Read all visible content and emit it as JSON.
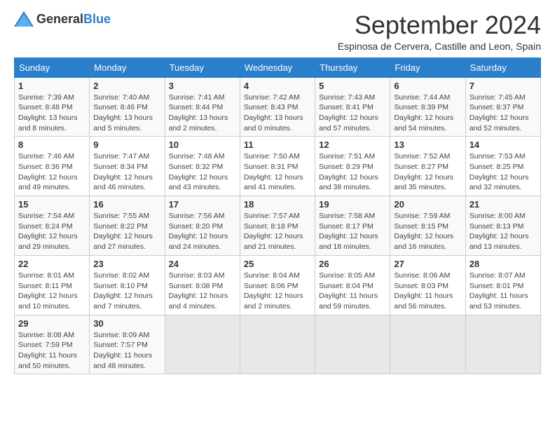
{
  "logo": {
    "general": "General",
    "blue": "Blue"
  },
  "title": "September 2024",
  "location": "Espinosa de Cervera, Castille and Leon, Spain",
  "headers": [
    "Sunday",
    "Monday",
    "Tuesday",
    "Wednesday",
    "Thursday",
    "Friday",
    "Saturday"
  ],
  "weeks": [
    [
      {
        "day": "1",
        "sunrise": "7:39 AM",
        "sunset": "8:48 PM",
        "daylight": "13 hours and 8 minutes."
      },
      {
        "day": "2",
        "sunrise": "7:40 AM",
        "sunset": "8:46 PM",
        "daylight": "13 hours and 5 minutes."
      },
      {
        "day": "3",
        "sunrise": "7:41 AM",
        "sunset": "8:44 PM",
        "daylight": "13 hours and 2 minutes."
      },
      {
        "day": "4",
        "sunrise": "7:42 AM",
        "sunset": "8:43 PM",
        "daylight": "13 hours and 0 minutes."
      },
      {
        "day": "5",
        "sunrise": "7:43 AM",
        "sunset": "8:41 PM",
        "daylight": "12 hours and 57 minutes."
      },
      {
        "day": "6",
        "sunrise": "7:44 AM",
        "sunset": "8:39 PM",
        "daylight": "12 hours and 54 minutes."
      },
      {
        "day": "7",
        "sunrise": "7:45 AM",
        "sunset": "8:37 PM",
        "daylight": "12 hours and 52 minutes."
      }
    ],
    [
      {
        "day": "8",
        "sunrise": "7:46 AM",
        "sunset": "8:36 PM",
        "daylight": "12 hours and 49 minutes."
      },
      {
        "day": "9",
        "sunrise": "7:47 AM",
        "sunset": "8:34 PM",
        "daylight": "12 hours and 46 minutes."
      },
      {
        "day": "10",
        "sunrise": "7:48 AM",
        "sunset": "8:32 PM",
        "daylight": "12 hours and 43 minutes."
      },
      {
        "day": "11",
        "sunrise": "7:50 AM",
        "sunset": "8:31 PM",
        "daylight": "12 hours and 41 minutes."
      },
      {
        "day": "12",
        "sunrise": "7:51 AM",
        "sunset": "8:29 PM",
        "daylight": "12 hours and 38 minutes."
      },
      {
        "day": "13",
        "sunrise": "7:52 AM",
        "sunset": "8:27 PM",
        "daylight": "12 hours and 35 minutes."
      },
      {
        "day": "14",
        "sunrise": "7:53 AM",
        "sunset": "8:25 PM",
        "daylight": "12 hours and 32 minutes."
      }
    ],
    [
      {
        "day": "15",
        "sunrise": "7:54 AM",
        "sunset": "8:24 PM",
        "daylight": "12 hours and 29 minutes."
      },
      {
        "day": "16",
        "sunrise": "7:55 AM",
        "sunset": "8:22 PM",
        "daylight": "12 hours and 27 minutes."
      },
      {
        "day": "17",
        "sunrise": "7:56 AM",
        "sunset": "8:20 PM",
        "daylight": "12 hours and 24 minutes."
      },
      {
        "day": "18",
        "sunrise": "7:57 AM",
        "sunset": "8:18 PM",
        "daylight": "12 hours and 21 minutes."
      },
      {
        "day": "19",
        "sunrise": "7:58 AM",
        "sunset": "8:17 PM",
        "daylight": "12 hours and 18 minutes."
      },
      {
        "day": "20",
        "sunrise": "7:59 AM",
        "sunset": "8:15 PM",
        "daylight": "12 hours and 16 minutes."
      },
      {
        "day": "21",
        "sunrise": "8:00 AM",
        "sunset": "8:13 PM",
        "daylight": "12 hours and 13 minutes."
      }
    ],
    [
      {
        "day": "22",
        "sunrise": "8:01 AM",
        "sunset": "8:11 PM",
        "daylight": "12 hours and 10 minutes."
      },
      {
        "day": "23",
        "sunrise": "8:02 AM",
        "sunset": "8:10 PM",
        "daylight": "12 hours and 7 minutes."
      },
      {
        "day": "24",
        "sunrise": "8:03 AM",
        "sunset": "8:08 PM",
        "daylight": "12 hours and 4 minutes."
      },
      {
        "day": "25",
        "sunrise": "8:04 AM",
        "sunset": "8:06 PM",
        "daylight": "12 hours and 2 minutes."
      },
      {
        "day": "26",
        "sunrise": "8:05 AM",
        "sunset": "8:04 PM",
        "daylight": "11 hours and 59 minutes."
      },
      {
        "day": "27",
        "sunrise": "8:06 AM",
        "sunset": "8:03 PM",
        "daylight": "11 hours and 56 minutes."
      },
      {
        "day": "28",
        "sunrise": "8:07 AM",
        "sunset": "8:01 PM",
        "daylight": "11 hours and 53 minutes."
      }
    ],
    [
      {
        "day": "29",
        "sunrise": "8:08 AM",
        "sunset": "7:59 PM",
        "daylight": "11 hours and 50 minutes."
      },
      {
        "day": "30",
        "sunrise": "8:09 AM",
        "sunset": "7:57 PM",
        "daylight": "11 hours and 48 minutes."
      },
      null,
      null,
      null,
      null,
      null
    ]
  ]
}
